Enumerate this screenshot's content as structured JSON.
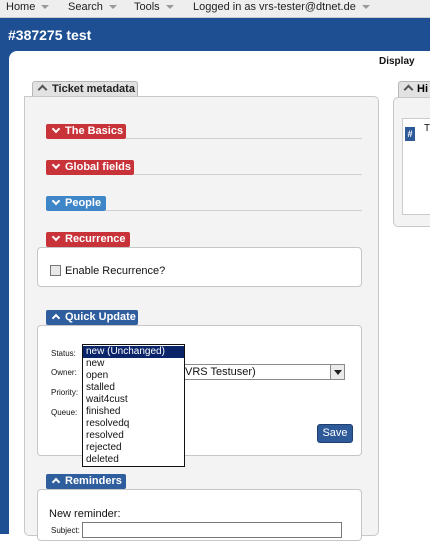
{
  "menu": [
    {
      "label": "Home"
    },
    {
      "label": "Search"
    },
    {
      "label": "Tools"
    },
    {
      "label": "Logged in as vrs-tester@dtnet.de"
    }
  ],
  "page_title": "#387275 test",
  "display_link": "Display",
  "ticket_metadata": {
    "tab_label": "Ticket metadata",
    "sections": {
      "basics": "The Basics",
      "global_fields": "Global fields",
      "people": "People",
      "recurrence": "Recurrence"
    },
    "recurrence": {
      "enable_label": "Enable Recurrence?"
    }
  },
  "quick_update": {
    "tab_label": "Quick Update",
    "labels": {
      "status": "Status:",
      "owner": "Owner:",
      "priority": "Priority:",
      "queue": "Queue:"
    },
    "owner_value": "VRS Testuser)",
    "status_options": [
      "new (Unchanged)",
      "new",
      "open",
      "stalled",
      "wait4cust",
      "finished",
      "resolvedq",
      "resolved",
      "rejected",
      "deleted"
    ],
    "selected_status_index": 0,
    "save_label": "Save"
  },
  "reminders": {
    "tab_label": "Reminders",
    "new_reminder_label": "New reminder:",
    "subject_label": "Subject:"
  },
  "history": {
    "tab_label": "Hi",
    "entry_prefix": "T",
    "badge": "#"
  },
  "colors": {
    "brand_blue": "#1f4f93",
    "section_red": "#c8333a",
    "section_blue": "#3f86c8",
    "selection_navy": "#0a246a"
  }
}
